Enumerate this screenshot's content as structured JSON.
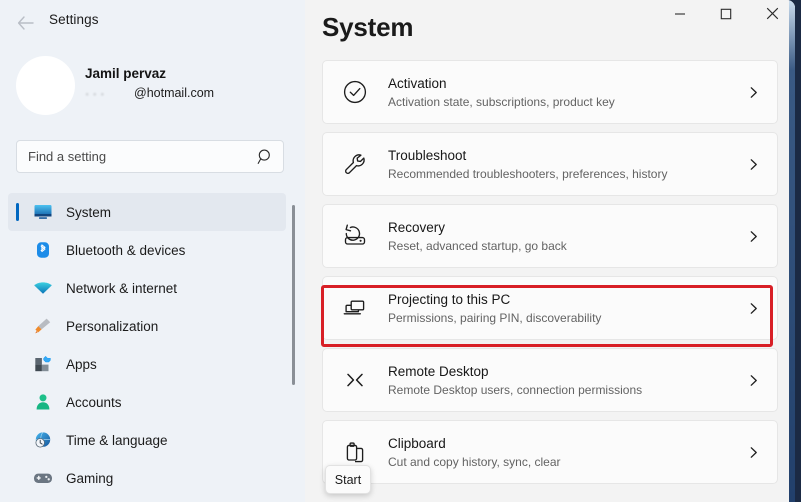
{
  "window": {
    "title": "Settings",
    "back_icon": "back-arrow-icon",
    "controls": {
      "minimize": "minimize-icon",
      "maximize": "maximize-icon",
      "close": "close-icon"
    }
  },
  "account": {
    "name": "Jamil pervaz",
    "email_redacted": "·   ·  ·",
    "email_domain": "@hotmail.com",
    "avatar": "user-avatar"
  },
  "search": {
    "placeholder": "Find a setting",
    "value": "",
    "icon": "search-icon"
  },
  "sidebar": {
    "items": [
      {
        "label": "System",
        "icon": "system-icon",
        "selected": true
      },
      {
        "label": "Bluetooth & devices",
        "icon": "bluetooth-icon",
        "selected": false
      },
      {
        "label": "Network & internet",
        "icon": "network-wifi-icon",
        "selected": false
      },
      {
        "label": "Personalization",
        "icon": "paintbrush-icon",
        "selected": false
      },
      {
        "label": "Apps",
        "icon": "apps-icon",
        "selected": false
      },
      {
        "label": "Accounts",
        "icon": "accounts-person-icon",
        "selected": false
      },
      {
        "label": "Time & language",
        "icon": "clock-globe-icon",
        "selected": false
      },
      {
        "label": "Gaming",
        "icon": "gamepad-icon",
        "selected": false
      }
    ]
  },
  "main": {
    "heading": "System",
    "cards": [
      {
        "title": "Activation",
        "subtitle": "Activation state, subscriptions, product key",
        "icon": "check-circle-icon",
        "highlighted": false
      },
      {
        "title": "Troubleshoot",
        "subtitle": "Recommended troubleshooters, preferences, history",
        "icon": "wrench-icon",
        "highlighted": false
      },
      {
        "title": "Recovery",
        "subtitle": "Reset, advanced startup, go back",
        "icon": "recovery-icon",
        "highlighted": false
      },
      {
        "title": "Projecting to this PC",
        "subtitle": "Permissions, pairing PIN, discoverability",
        "icon": "project-screens-icon",
        "highlighted": true
      },
      {
        "title": "Remote Desktop",
        "subtitle": "Remote Desktop users, connection permissions",
        "icon": "remote-desktop-icon",
        "highlighted": false
      },
      {
        "title": "Clipboard",
        "subtitle": "Cut and copy history, sync, clear",
        "icon": "clipboard-icon",
        "highlighted": false
      }
    ]
  },
  "tooltip": {
    "label": "Start"
  },
  "colors": {
    "accent": "#0067c0",
    "highlight": "#d81f26",
    "sidebar_bg": "#eef2f7",
    "content_bg": "#f3f3f3",
    "card_bg": "#fbfbfb"
  }
}
